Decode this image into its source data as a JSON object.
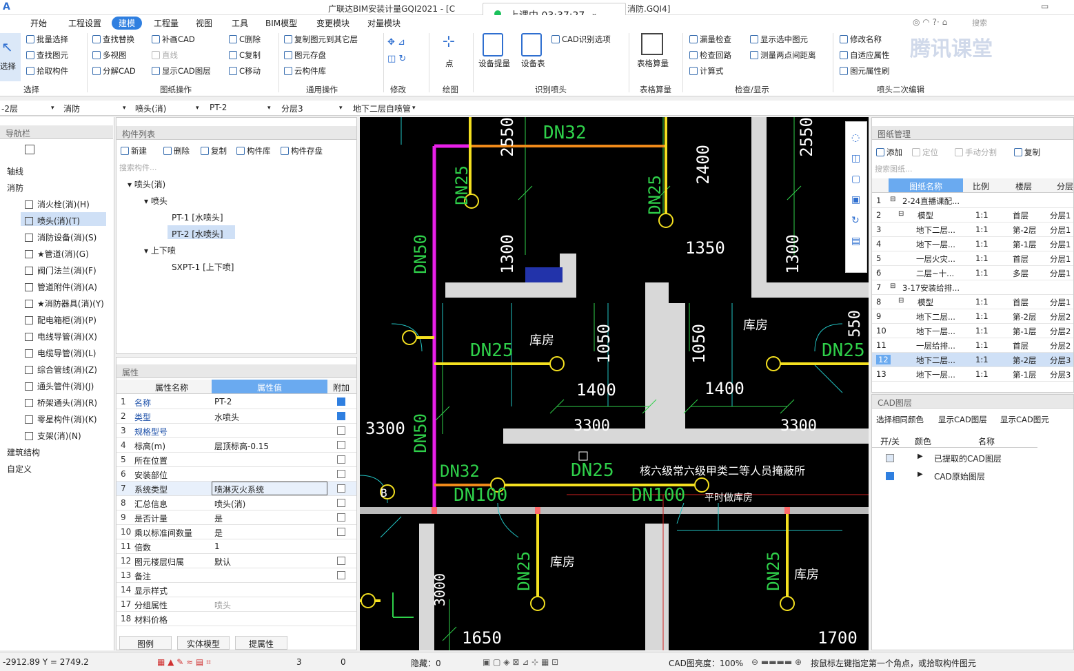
{
  "window": {
    "title": "广联达BIM安装计量GQI2021 - [C",
    "title_suffix": "消防.GQI4]",
    "search_placeholder": "搜索"
  },
  "live": {
    "label": "上课中 03:37:27"
  },
  "watermark": "腾讯课堂",
  "menu": [
    "开始",
    "工程设置",
    "建模",
    "工程量",
    "视图",
    "工具",
    "BIM模型",
    "变更模块",
    "对量模块"
  ],
  "ribbon": {
    "select": "选择",
    "items": [
      "批量选择",
      "查找替换",
      "补画CAD",
      "C删除",
      "复制图元到其它层",
      "查找图元",
      "多视图",
      "直线",
      "C复制",
      "图元存盘",
      "拾取构件",
      "分解CAD",
      "显示CAD图层",
      "C移动",
      "云构件库",
      "点",
      "设备提量",
      "设备表",
      "CAD识别选项",
      "表格算量",
      "漏量检查",
      "显示选中图元",
      "检查回路",
      "测量两点间距离",
      "计算式",
      "修改名称",
      "自适应属性",
      "图元属性刷"
    ],
    "groups": [
      "选择",
      "图纸操作",
      "通用操作",
      "修改",
      "绘图",
      "识别喷头",
      "表格算量",
      "检查/显示",
      "喷头二次编辑"
    ]
  },
  "filters": [
    "-2层",
    "消防",
    "喷头(消)",
    "PT-2",
    "分层3",
    "地下二层自喷管"
  ],
  "nav": {
    "title": "导航栏",
    "items": [
      "轴线",
      "消防",
      "消火栓(消)(H)",
      "喷头(消)(T)",
      "消防设备(消)(S)",
      "★管道(消)(G)",
      "阀门法兰(消)(F)",
      "管道附件(消)(A)",
      "★消防器具(消)(Y)",
      "配电箱柜(消)(P)",
      "电线导管(消)(X)",
      "电缆导管(消)(L)",
      "综合管线(消)(Z)",
      "通头管件(消)(J)",
      "桥架通头(消)(R)",
      "零星构件(消)(K)",
      "支架(消)(N)",
      "建筑结构",
      "自定义"
    ]
  },
  "components": {
    "title": "构件列表",
    "toolbar": [
      "新建",
      "删除",
      "复制",
      "构件库",
      "构件存盘"
    ],
    "search": "搜索构件...",
    "tree": [
      "喷头(消)",
      "喷头",
      "PT-1 [水喷头]",
      "PT-2 [水喷头]",
      "上下喷",
      "SXPT-1 [上下喷]"
    ]
  },
  "props": {
    "title": "属性",
    "headers": [
      "属性名称",
      "属性值",
      "附加"
    ],
    "rows": [
      {
        "n": "1",
        "k": "名称",
        "v": "PT-2"
      },
      {
        "n": "2",
        "k": "类型",
        "v": "水喷头"
      },
      {
        "n": "3",
        "k": "规格型号",
        "v": ""
      },
      {
        "n": "4",
        "k": "标高(m)",
        "v": "层顶标高-0.15"
      },
      {
        "n": "5",
        "k": "所在位置",
        "v": ""
      },
      {
        "n": "6",
        "k": "安装部位",
        "v": ""
      },
      {
        "n": "7",
        "k": "系统类型",
        "v": "喷淋灭火系统"
      },
      {
        "n": "8",
        "k": "汇总信息",
        "v": "喷头(消)"
      },
      {
        "n": "9",
        "k": "是否计量",
        "v": "是"
      },
      {
        "n": "10",
        "k": "乘以标准间数量",
        "v": "是"
      },
      {
        "n": "11",
        "k": "倍数",
        "v": "1"
      },
      {
        "n": "12",
        "k": "图元楼层归属",
        "v": "默认"
      },
      {
        "n": "13",
        "k": "备注",
        "v": ""
      },
      {
        "n": "14",
        "k": "显示样式",
        "v": ""
      },
      {
        "n": "17",
        "k": "分组属性",
        "v": "喷头"
      },
      {
        "n": "18",
        "k": "材料价格",
        "v": ""
      }
    ],
    "buttons": [
      "图例",
      "实体模型",
      "提属性"
    ]
  },
  "drawings": {
    "title": "图纸管理",
    "toolbar": [
      "添加",
      "定位",
      "手动分割",
      "复制"
    ],
    "search": "搜索图纸...",
    "headers": [
      "图纸名称",
      "比例",
      "楼层",
      "分层"
    ],
    "rows": [
      {
        "n": "1",
        "name": "2-24直播课配...",
        "s": "",
        "f": "",
        "l": ""
      },
      {
        "n": "2",
        "name": "模型",
        "s": "1:1",
        "f": "首层",
        "l": "分层1"
      },
      {
        "n": "3",
        "name": "地下二层...",
        "s": "1:1",
        "f": "第-2层",
        "l": "分层1"
      },
      {
        "n": "4",
        "name": "地下一层...",
        "s": "1:1",
        "f": "第-1层",
        "l": "分层1"
      },
      {
        "n": "5",
        "name": "一层火灾...",
        "s": "1:1",
        "f": "首层",
        "l": "分层1"
      },
      {
        "n": "6",
        "name": "二层~十...",
        "s": "1:1",
        "f": "多层",
        "l": "分层1"
      },
      {
        "n": "7",
        "name": "3-17安装给排...",
        "s": "",
        "f": "",
        "l": ""
      },
      {
        "n": "8",
        "name": "模型",
        "s": "1:1",
        "f": "首层",
        "l": "分层1"
      },
      {
        "n": "9",
        "name": "地下二层...",
        "s": "1:1",
        "f": "第-2层",
        "l": "分层2"
      },
      {
        "n": "10",
        "name": "地下一层...",
        "s": "1:1",
        "f": "第-1层",
        "l": "分层2"
      },
      {
        "n": "11",
        "name": "一层给排...",
        "s": "1:1",
        "f": "首层",
        "l": "分层2"
      },
      {
        "n": "12",
        "name": "地下二层...",
        "s": "1:1",
        "f": "第-2层",
        "l": "分层3"
      },
      {
        "n": "13",
        "name": "地下一层...",
        "s": "1:1",
        "f": "第-1层",
        "l": "分层3"
      }
    ]
  },
  "cad": {
    "title": "CAD图层",
    "toolbar": [
      "选择相同颜色",
      "显示CAD图层",
      "显示CAD图元"
    ],
    "headers": [
      "开/关",
      "颜色",
      "名称"
    ],
    "rows": [
      "已提取的CAD图层",
      "CAD原始图层"
    ]
  },
  "canvas_labels": [
    "DN32",
    "DN25",
    "DN25",
    "DN50",
    "DN25",
    "DN25",
    "DN50",
    "DN32",
    "DN25",
    "DN100",
    "DN100",
    "DN25",
    "DN25",
    "2550",
    "2550",
    "2400",
    "1300",
    "1300",
    "1350",
    "1050",
    "1050",
    "550",
    "1400",
    "1400",
    "3300",
    "3300",
    "3300",
    "3000",
    "1650",
    "1700",
    "库房",
    "库房",
    "库房",
    "库房",
    "核六级常六级甲类二等人员掩蔽所",
    "平时做库房",
    "B"
  ],
  "status": {
    "coords": "-2912.89 Y = 2749.2",
    "hidden": "隐藏：0",
    "brightness": "CAD图亮度：100%",
    "hint": "按鼠标左键指定第一个角点，或拾取构件图元",
    "zero": "0",
    "three": "3"
  }
}
